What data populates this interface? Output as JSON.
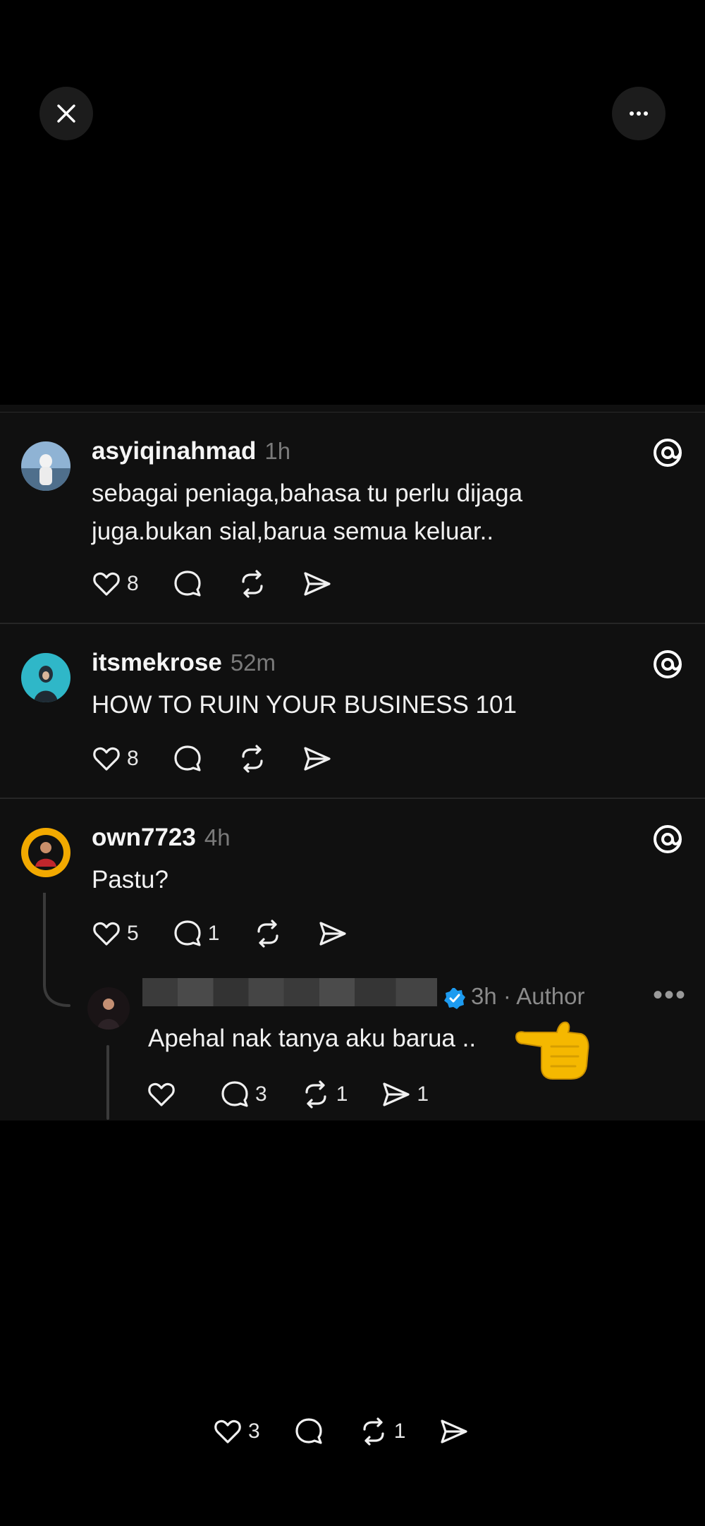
{
  "top_bar": {
    "close_icon": "close-icon",
    "more_icon": "ellipsis-icon"
  },
  "posts": [
    {
      "username": "asyiqinahmad",
      "time": "1h",
      "text": "sebagai peniaga,bahasa tu perlu dijaga juga.bukan sial,barua semua keluar..",
      "likes": "8"
    },
    {
      "username": "itsmekrose",
      "time": "52m",
      "text": "HOW TO RUIN YOUR BUSINESS 101",
      "likes": "8"
    },
    {
      "username": "own7723",
      "time": "4h",
      "text": "Pastu?",
      "likes": "5",
      "replies": "1"
    }
  ],
  "reply": {
    "meta": "3h · Author",
    "more": "•••",
    "text": "Apehal nak tanya aku barua ..",
    "replies": "3",
    "reposts": "1",
    "shares": "1"
  },
  "footer": {
    "likes": "3",
    "reposts": "1"
  },
  "colors": {
    "background": "#000000",
    "panel": "#101010",
    "verified": "#1d9bf0",
    "muted": "#7a7a7a"
  }
}
